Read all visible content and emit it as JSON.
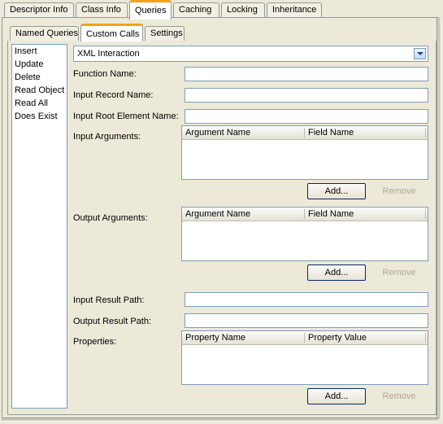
{
  "window": {
    "background_color": "#ECE9D8",
    "accent_color": "#F5A11A",
    "field_border_color": "#7F9DB9"
  },
  "main_tabs": [
    {
      "label": "Descriptor Info",
      "selected": false
    },
    {
      "label": "Class Info",
      "selected": false
    },
    {
      "label": "Queries",
      "selected": true
    },
    {
      "label": "Caching",
      "selected": false
    },
    {
      "label": "Locking",
      "selected": false
    },
    {
      "label": "Inheritance",
      "selected": false
    }
  ],
  "sub_tabs": [
    {
      "label": "Named Queries",
      "selected": false
    },
    {
      "label": "Custom Calls",
      "selected": true
    },
    {
      "label": "Settings",
      "selected": false
    }
  ],
  "query_list": {
    "items": [
      {
        "label": "Insert"
      },
      {
        "label": "Update"
      },
      {
        "label": "Delete"
      },
      {
        "label": "Read Object"
      },
      {
        "label": "Read All"
      },
      {
        "label": "Does Exist"
      }
    ]
  },
  "call_type": {
    "selected": "XML Interaction",
    "icon": "chevron-down-icon"
  },
  "fields": {
    "function_name": {
      "label": "Function Name:",
      "value": "",
      "placeholder": ""
    },
    "input_record_name": {
      "label": "Input Record Name:",
      "value": "",
      "placeholder": ""
    },
    "input_root_element_name": {
      "label": "Input Root Element Name:",
      "value": "",
      "placeholder": ""
    },
    "input_result_path": {
      "label": "Input Result Path:",
      "value": "",
      "placeholder": ""
    },
    "output_result_path": {
      "label": "Output Result Path:",
      "value": "",
      "placeholder": ""
    }
  },
  "input_arguments": {
    "label": "Input Arguments:",
    "columns": [
      "Argument Name",
      "Field Name"
    ],
    "rows": [],
    "add_label": "Add...",
    "remove_label": "Remove",
    "add_enabled": true,
    "remove_enabled": false
  },
  "output_arguments": {
    "label": "Output Arguments:",
    "columns": [
      "Argument Name",
      "Field Name"
    ],
    "rows": [],
    "add_label": "Add...",
    "remove_label": "Remove",
    "add_enabled": true,
    "remove_enabled": false
  },
  "properties": {
    "label": "Properties:",
    "columns": [
      "Property Name",
      "Property Value"
    ],
    "rows": [],
    "add_label": "Add...",
    "remove_label": "Remove",
    "add_enabled": true,
    "remove_enabled": false
  }
}
